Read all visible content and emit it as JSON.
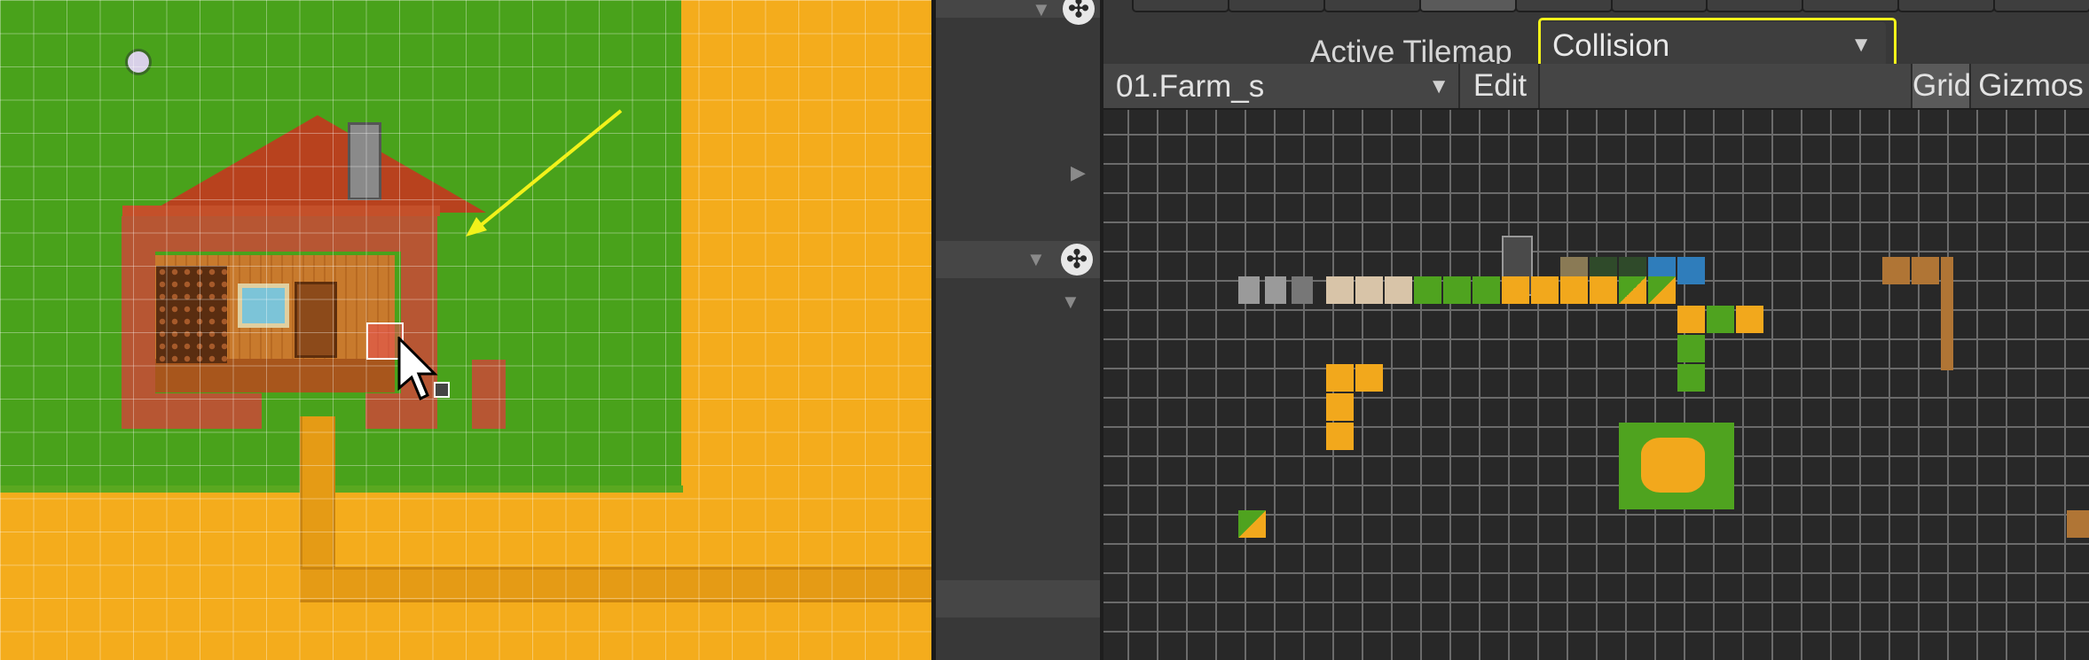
{
  "active_tilemap": {
    "label": "Active Tilemap",
    "selected": "Collision"
  },
  "palette": {
    "selected": "01.Farm_s",
    "edit_label": "Edit",
    "grid_label": "Grid",
    "gizmos_label": "Gizmos"
  },
  "colors": {
    "annotation_highlight": "#f2f21a",
    "collision_overlay": "#dc3c3c",
    "grass": "#49a21b",
    "sand": "#f4ac1c",
    "editor_bg": "#383838"
  },
  "icons": {
    "dropdown": "triangle-down",
    "fold": "triangle-right",
    "game_object": "unity-logo",
    "cursor": "mouse-arrow",
    "annotation": "arrow"
  }
}
